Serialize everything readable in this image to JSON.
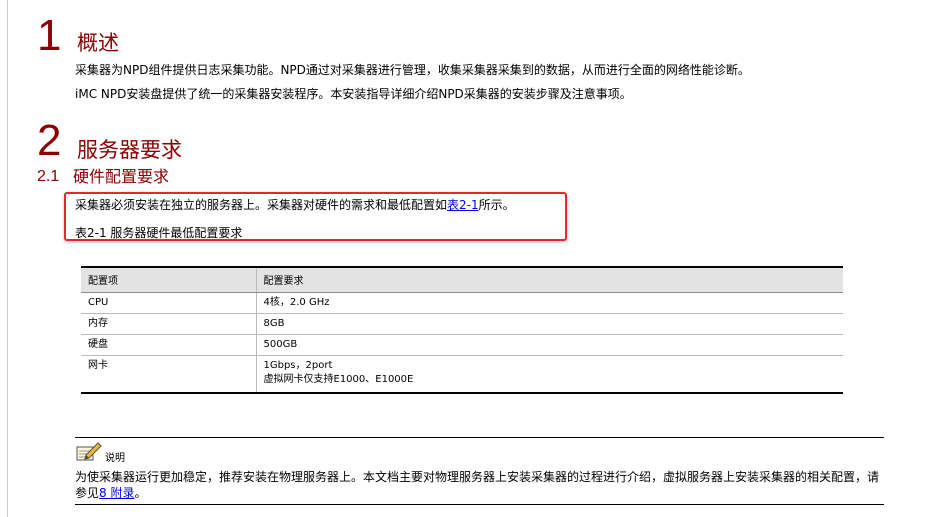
{
  "section1": {
    "number": "1",
    "title": "概述",
    "para1": "采集器为NPD组件提供日志采集功能。NPD通过对采集器进行管理，收集采集器采集到的数据，从而进行全面的网络性能诊断。",
    "para2": "iMC NPD安装盘提供了统一的采集器安装程序。本安装指导详细介绍NPD采集器的安装步骤及注意事项。"
  },
  "section2": {
    "number": "2",
    "title": "服务器要求",
    "sub_number": "2.1",
    "sub_title": "硬件配置要求",
    "para_before": "采集器必须安装在独立的服务器上。采集器对硬件的需求和最低配置如",
    "para_link": "表2-1",
    "para_after": "所示。",
    "table_caption": "表2-1 服务器硬件最低配置要求"
  },
  "table": {
    "headers": [
      "配置项",
      "配置要求"
    ],
    "rows": [
      {
        "item": "CPU",
        "req": "4核，2.0 GHz",
        "req2": ""
      },
      {
        "item": "内存",
        "req": "8GB",
        "req2": ""
      },
      {
        "item": "硬盘",
        "req": "500GB",
        "req2": ""
      },
      {
        "item": "网卡",
        "req": "1Gbps，2port",
        "req2": "虚拟网卡仅支持E1000、E1000E"
      }
    ]
  },
  "note": {
    "icon": "note-pencil-icon",
    "label": "说明",
    "body_before": "为使采集器运行更加稳定，推荐安装在物理服务器上。本文档主要对物理服务器上安装采集器的过程进行介绍，虚拟服务器上安装采集器的相关配置，请参见",
    "body_link": "8 附录",
    "body_after": "。"
  },
  "colors": {
    "heading": "#8b0000",
    "highlight_border": "#e8262b",
    "link": "#0000ee",
    "table_header_bg": "#e3e3e3"
  }
}
